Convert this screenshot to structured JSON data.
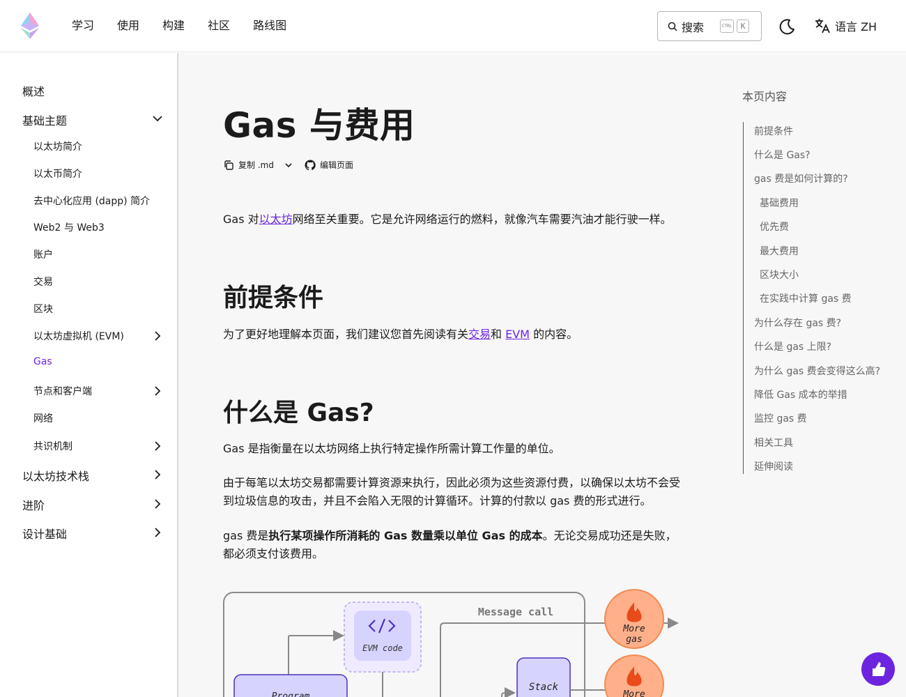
{
  "header": {
    "nav": [
      "学习",
      "使用",
      "构建",
      "社区",
      "路线图"
    ],
    "search_label": "搜索",
    "kbd_ctrl": "CTRL",
    "kbd_k": "K",
    "language_label": "语言 ZH"
  },
  "sidebar": {
    "overview": "概述",
    "foundational": "基础主题",
    "sub": [
      "以太坊简介",
      "以太币简介",
      "去中心化应用 (dapp) 简介",
      "Web2 与 Web3",
      "账户",
      "交易",
      "区块",
      "以太坊虚拟机 (EVM)",
      "Gas",
      "节点和客户端",
      "网络",
      "共识机制"
    ],
    "stack": "以太坊技术栈",
    "advanced": "进阶",
    "design": "设计基础"
  },
  "main": {
    "title": "Gas 与费用",
    "copy_md": "复制 .md",
    "edit_page": "编辑页面",
    "intro_pre": "Gas 对",
    "intro_link": "以太坊",
    "intro_post": "网络至关重要。它是允许网络运行的燃料，就像汽车需要汽油才能行驶一样。",
    "h_prereq": "前提条件",
    "prereq_pre": "为了更好地理解本页面，我们建议您首先阅读有关",
    "prereq_link1": "交易",
    "prereq_mid": "和 ",
    "prereq_link2": "EVM",
    "prereq_post": " 的内容。",
    "h_what": "什么是 Gas?",
    "what_p1": "Gas 是指衡量在以太坊网络上执行特定操作所需计算工作量的单位。",
    "what_p2": "由于每笔以太坊交易都需要计算资源来执行，因此必须为这些资源付费，以确保以太坊不会受到垃圾信息的攻击，并且不会陷入无限的计算循环。计算的付款以 gas 费的形式进行。",
    "what_p3_pre": "gas 费是",
    "what_p3_bold": "执行某项操作所消耗的 Gas 数量乘以单位 Gas 的成本",
    "what_p3_post": "。无论交易成功还是失败，都必须支付该费用。"
  },
  "diagram": {
    "evm_code": "EVM code",
    "message_call": "Message call",
    "more_gas_1a": "More",
    "more_gas_1b": "gas",
    "stack": "Stack",
    "more_gas_2a": "More",
    "program": "Program"
  },
  "toc": {
    "title": "本页内容",
    "items": [
      "前提条件",
      "什么是 Gas?",
      "gas 费是如何计算的?",
      "基础费用",
      "优先费",
      "最大费用",
      "区块大小",
      "在实践中计算 gas 费",
      "为什么存在 gas 费?",
      "什么是 gas 上限?",
      "为什么 gas 费会变得这么高?",
      "降低 Gas 成本的举措",
      "监控 gas 费",
      "相关工具",
      "延伸阅读"
    ]
  },
  "colors": {
    "accent": "#6c24df",
    "flame_bg": "#ffb08a",
    "box_purple": "#d7d3ff"
  }
}
